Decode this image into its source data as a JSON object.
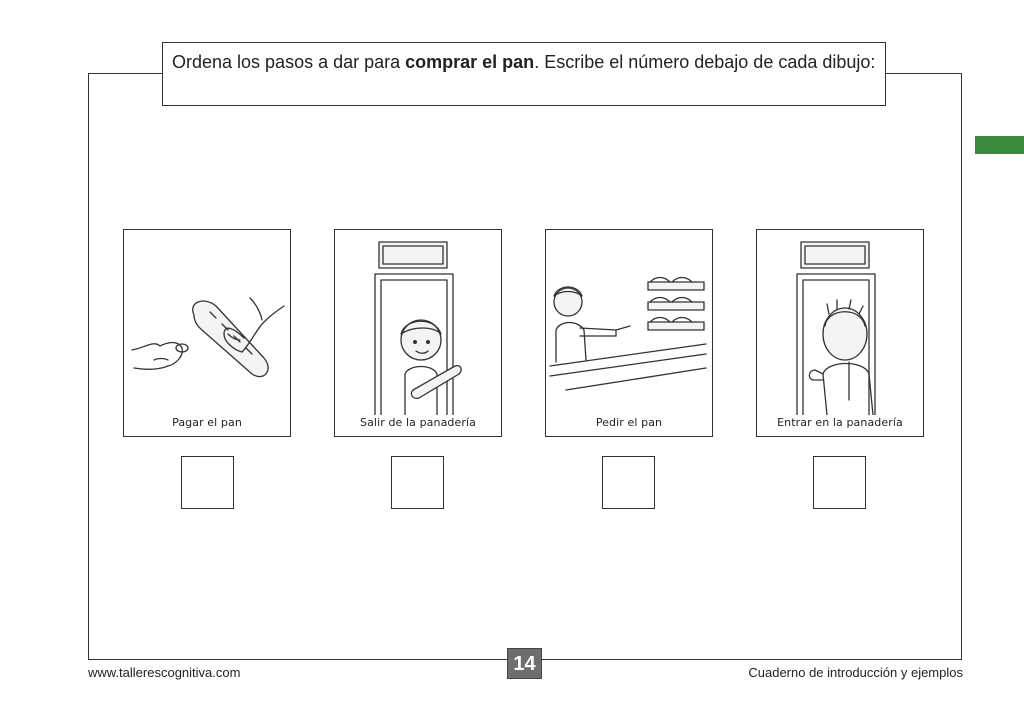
{
  "instruction": {
    "text_before": "Ordena los pasos a dar para ",
    "text_bold": "comprar el pan",
    "text_after": ". Escribe el número debajo de cada dibujo:"
  },
  "cards": [
    {
      "caption": "Pagar el pan",
      "illustration": "hands-paying-bread"
    },
    {
      "caption": "Salir de la panadería",
      "illustration": "boy-leaving-door-with-bread"
    },
    {
      "caption": "Pedir el pan",
      "illustration": "boy-pointing-at-bread-shelves"
    },
    {
      "caption": "Entrar en la panadería",
      "illustration": "boy-entering-door"
    }
  ],
  "answers": [
    "",
    "",
    "",
    ""
  ],
  "footer": {
    "website": "www.tallerescognitiva.com",
    "page_number": "14",
    "book_title": "Cuaderno de introducción y ejemplos"
  },
  "colors": {
    "accent_tab": "#3c8a3c",
    "page_number_bg": "#6e6e6e"
  }
}
